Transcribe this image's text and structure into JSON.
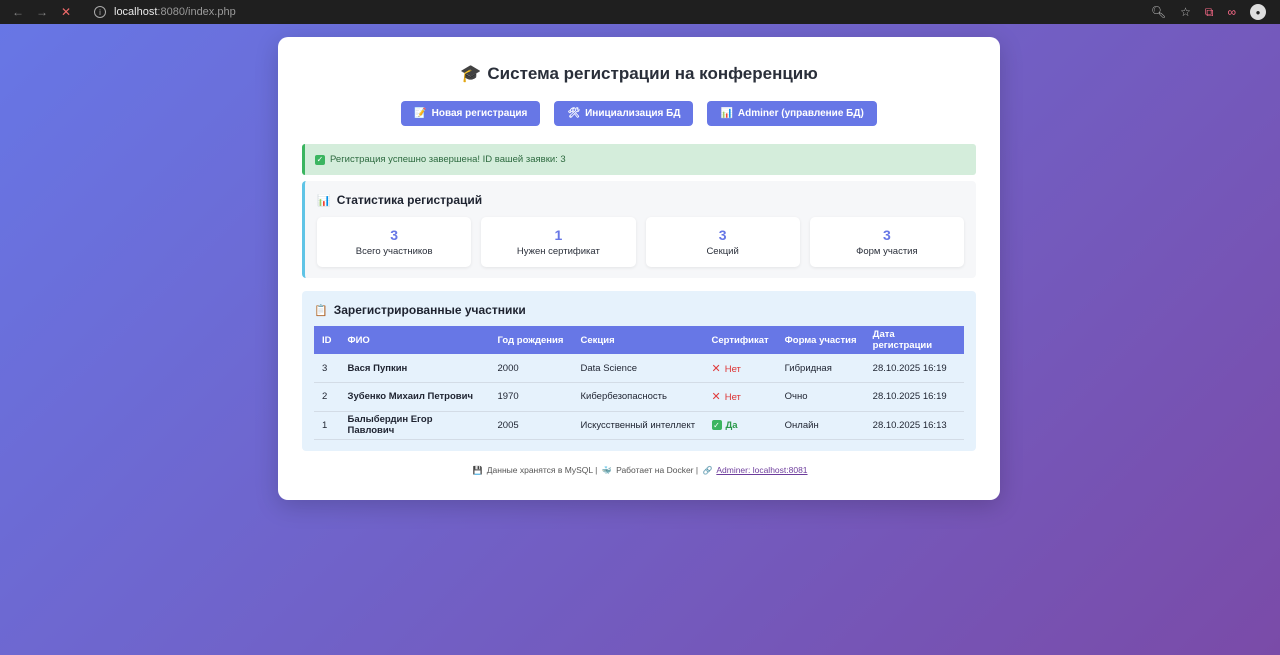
{
  "browser": {
    "url_host": "localhost",
    "url_path": ":8080/index.php"
  },
  "page": {
    "title": "Система регистрации на конференцию"
  },
  "buttons": {
    "new_registration": "Новая регистрация",
    "init_db": "Инициализация БД",
    "adminer": "Adminer (управление БД)"
  },
  "alert": {
    "message": "Регистрация успешно завершена! ID вашей заявки: 3"
  },
  "stats": {
    "title": "Статистика регистраций",
    "items": [
      {
        "value": "3",
        "label": "Всего участников"
      },
      {
        "value": "1",
        "label": "Нужен сертификат"
      },
      {
        "value": "3",
        "label": "Секций"
      },
      {
        "value": "3",
        "label": "Форм участия"
      }
    ]
  },
  "participants": {
    "title": "Зарегистрированные участники",
    "columns": [
      "ID",
      "ФИО",
      "Год рождения",
      "Секция",
      "Сертификат",
      "Форма участия",
      "Дата регистрации"
    ],
    "rows": [
      {
        "id": "3",
        "name": "Вася Пупкин",
        "birth_year": "2000",
        "section": "Data Science",
        "certificate": "Нет",
        "form": "Гибридная",
        "date": "28.10.2025 16:19"
      },
      {
        "id": "2",
        "name": "Зубенко Михаил Петрович",
        "birth_year": "1970",
        "section": "Кибербезопасность",
        "certificate": "Нет",
        "form": "Очно",
        "date": "28.10.2025 16:19"
      },
      {
        "id": "1",
        "name": "Балыбердин Егор Павлович",
        "birth_year": "2005",
        "section": "Искусственный интеллект",
        "certificate": "Да",
        "form": "Онлайн",
        "date": "28.10.2025 16:13"
      }
    ]
  },
  "footer": {
    "mysql": "Данные хранятся в MySQL |",
    "docker": "Работает на Docker |",
    "adminer_link": "Adminer: localhost:8081"
  },
  "colors": {
    "accent": "#6777e6",
    "success": "#3bb560",
    "danger": "#e03a3a"
  }
}
